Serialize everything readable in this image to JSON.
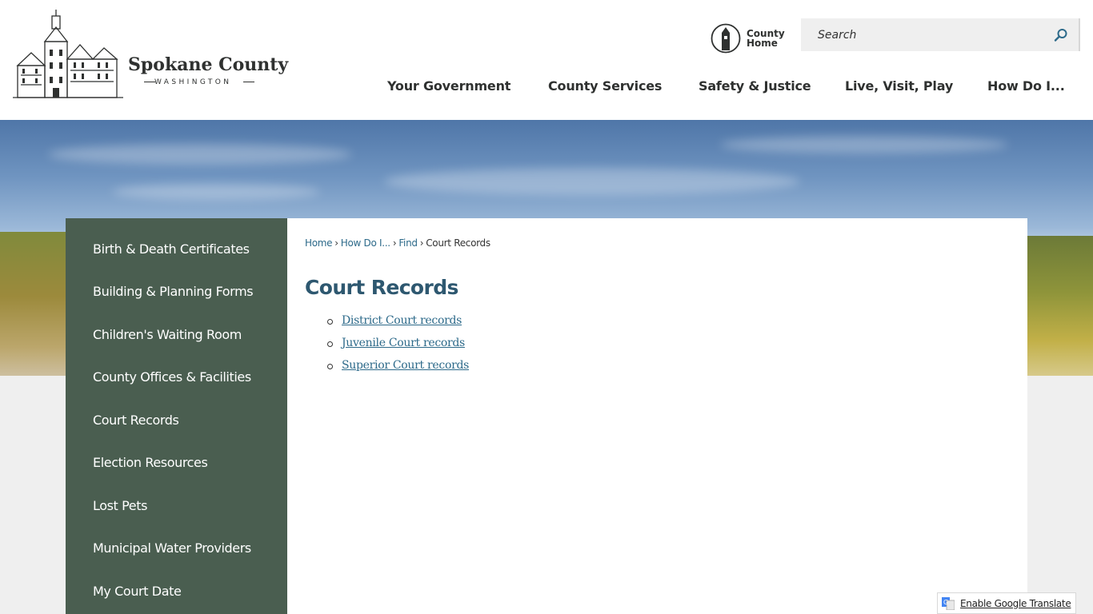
{
  "header": {
    "logo": {
      "name": "Spokane County",
      "sub": "WASHINGTON"
    },
    "county_home": {
      "line1": "County",
      "line2": "Home"
    },
    "search": {
      "placeholder": "Search"
    },
    "nav": [
      "Your Government",
      "County Services",
      "Safety & Justice",
      "Live, Visit, Play",
      "How Do I..."
    ]
  },
  "sidebar": {
    "items": [
      "Birth & Death Certificates",
      "Building & Planning Forms",
      "Children's Waiting Room",
      "County Offices & Facilities",
      "Court Records",
      "Election Resources",
      "Lost Pets",
      "Municipal Water Providers",
      "My Court Date"
    ]
  },
  "main": {
    "breadcrumb": [
      "Home",
      "How Do I...",
      "Find",
      "Court Records"
    ],
    "title": "Court Records",
    "links": [
      "District Court records",
      "Juvenile Court records",
      "Superior Court records"
    ]
  },
  "footer": {
    "translate_label": "Enable Google Translate"
  },
  "colors": {
    "sidebar_bg": "#4a5e50",
    "link": "#2d6a8a",
    "title": "#2e5870",
    "text_dark": "#2f3130"
  }
}
